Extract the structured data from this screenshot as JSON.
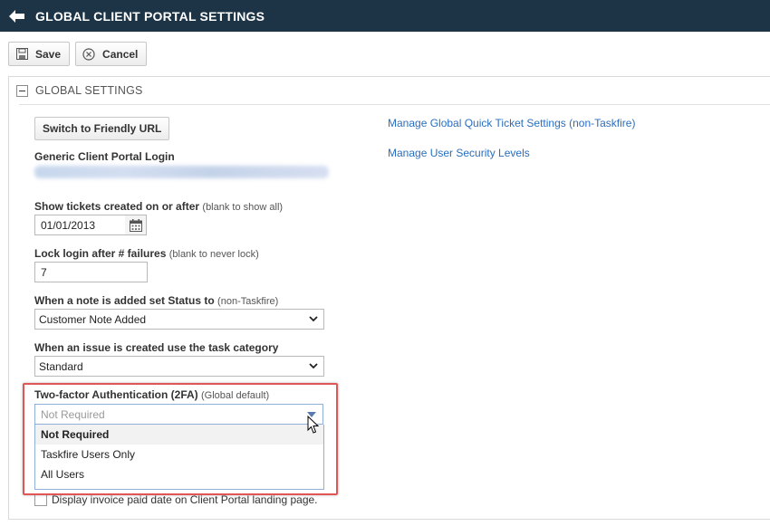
{
  "header": {
    "title": "GLOBAL CLIENT PORTAL SETTINGS",
    "back_icon": "arrow-left-icon"
  },
  "toolbar": {
    "save_label": "Save",
    "cancel_label": "Cancel",
    "save_icon": "floppy-disk-icon",
    "cancel_icon": "cancel-circle-icon"
  },
  "panel": {
    "title": "GLOBAL SETTINGS"
  },
  "form": {
    "friendly_url_button": "Switch to Friendly URL",
    "generic_login_label": "Generic Client Portal Login",
    "show_tickets_label": "Show tickets created on or after",
    "show_tickets_hint": "(blank to show all)",
    "show_tickets_value": "01/01/2013",
    "lock_login_label": "Lock login after # failures",
    "lock_login_hint": "(blank to never lock)",
    "lock_login_value": "7",
    "note_status_label": "When a note is added set Status to",
    "note_status_hint": "(non-Taskfire)",
    "note_status_value": "Customer Note Added",
    "task_category_label": "When an issue is created use the task category",
    "task_category_value": "Standard",
    "tfa_label": "Two-factor Authentication (2FA)",
    "tfa_hint": "(Global default)",
    "tfa_placeholder": "Not Required",
    "tfa_options": [
      "Not Required",
      "Taskfire Users Only",
      "All Users"
    ],
    "invoice_checkbox_label": "Display invoice paid date on Client Portal landing page."
  },
  "links": {
    "quick_ticket": "Manage Global Quick Ticket Settings (non-Taskfire)",
    "security_levels": "Manage User Security Levels"
  },
  "colors": {
    "header_bg": "#1d3447",
    "link": "#2a6ebf",
    "highlight": "#e05555"
  }
}
